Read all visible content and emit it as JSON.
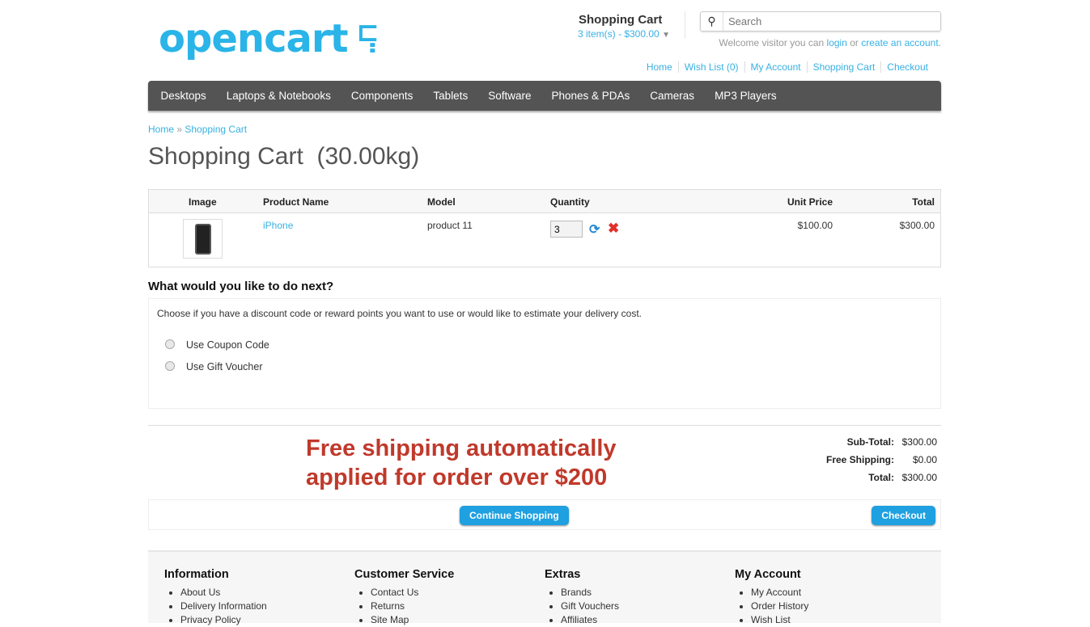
{
  "logo": "opencart",
  "header": {
    "cart_title": "Shopping Cart",
    "cart_summary": "3 item(s) - $300.00",
    "search_placeholder": "Search",
    "welcome_pre": "Welcome visitor you can ",
    "login": "login",
    "or": " or ",
    "create": "create an account",
    "dot": ".",
    "links": [
      "Home",
      "Wish List (0)",
      "My Account",
      "Shopping Cart",
      "Checkout"
    ]
  },
  "menu": [
    "Desktops",
    "Laptops & Notebooks",
    "Components",
    "Tablets",
    "Software",
    "Phones & PDAs",
    "Cameras",
    "MP3 Players"
  ],
  "breadcrumb": {
    "home": "Home",
    "sep": " » ",
    "current": "Shopping Cart"
  },
  "title": "Shopping Cart  (30.00kg)",
  "table": {
    "headers": [
      "Image",
      "Product Name",
      "Model",
      "Quantity",
      "Unit Price",
      "Total"
    ],
    "row": {
      "name": "iPhone",
      "model": "product 11",
      "qty": "3",
      "unit": "$100.00",
      "total": "$300.00"
    }
  },
  "next": {
    "title": "What would you like to do next?",
    "desc": "Choose if you have a discount code or reward points you want to use or would like to estimate your delivery cost.",
    "options": [
      "Use Coupon Code",
      "Use Gift Voucher"
    ]
  },
  "promo": [
    "Free shipping automatically",
    "applied for order over $200"
  ],
  "totals": [
    {
      "label": "Sub-Total:",
      "value": "$300.00"
    },
    {
      "label": "Free Shipping:",
      "value": "$0.00"
    },
    {
      "label": "Total:",
      "value": "$300.00"
    }
  ],
  "buttons": {
    "continue": "Continue Shopping",
    "checkout": "Checkout"
  },
  "footer": [
    {
      "title": "Information",
      "items": [
        "About Us",
        "Delivery Information",
        "Privacy Policy"
      ]
    },
    {
      "title": "Customer Service",
      "items": [
        "Contact Us",
        "Returns",
        "Site Map"
      ]
    },
    {
      "title": "Extras",
      "items": [
        "Brands",
        "Gift Vouchers",
        "Affiliates"
      ]
    },
    {
      "title": "My Account",
      "items": [
        "My Account",
        "Order History",
        "Wish List"
      ]
    }
  ]
}
